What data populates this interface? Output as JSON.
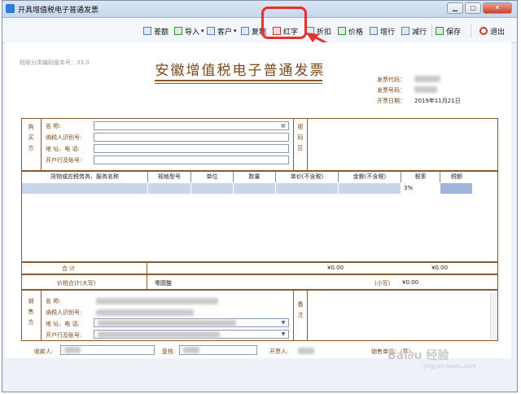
{
  "window": {
    "title": "开具增值税电子普通发票"
  },
  "toolbar": {
    "buttons": [
      {
        "label": "差额"
      },
      {
        "label": "导入",
        "dropdown": "▾"
      },
      {
        "label": "客户",
        "dropdown": "▾"
      },
      {
        "label": "复制"
      },
      {
        "label": "红字"
      },
      {
        "label": "折扣"
      },
      {
        "label": "价格"
      },
      {
        "label": "增行"
      },
      {
        "label": "减行"
      },
      {
        "label": "保存"
      },
      {
        "label": "退出"
      }
    ]
  },
  "doc": {
    "version": "税收分类编码版本号：33.0",
    "title": "安徽增值税电子普通发票",
    "meta": {
      "code_label": "发票代码：",
      "number_label": "发票号码：",
      "date_label": "开票日期：",
      "date_value": "2019年11月21日"
    },
    "buyer": {
      "side": "购买方",
      "name_label": "名        称:",
      "taxid_label": "纳税人识别号:",
      "addr_label": "地 址、电 话:",
      "bank_label": "开户行及账号:"
    },
    "cipher": "密码区",
    "columns": [
      "货物或应税劳务、服务名称",
      "规格型号",
      "单位",
      "数量",
      "单价(不含税)",
      "金额(不含税)",
      "税率",
      "税额"
    ],
    "row": {
      "tax_rate": "3%"
    },
    "total": {
      "label": "合        计",
      "amount": "¥0.00",
      "tax": "¥0.00"
    },
    "sum": {
      "label": "价税合计(大写)",
      "uppercase": "零圆整",
      "small_label": "(小写)",
      "small_value": "¥0.00"
    },
    "seller": {
      "side": "销售方",
      "name_label": "名        称:",
      "taxid_label": "纳税人识别号:",
      "addr_label": "地 址、电 话:",
      "bank_label": "开户行及账号:"
    },
    "remark": "备注",
    "footer": {
      "payee_label": "收款人:",
      "reviewer_label": "复核:",
      "drawer_label": "开票人:",
      "seller_stamp": "销售单位：（章）"
    }
  },
  "watermark": {
    "main": "Bai∂u 经验",
    "sub": "jingyan.baidu.com"
  },
  "colors": {
    "highlight": "#e8312c",
    "accent": "#7a4a1a"
  }
}
